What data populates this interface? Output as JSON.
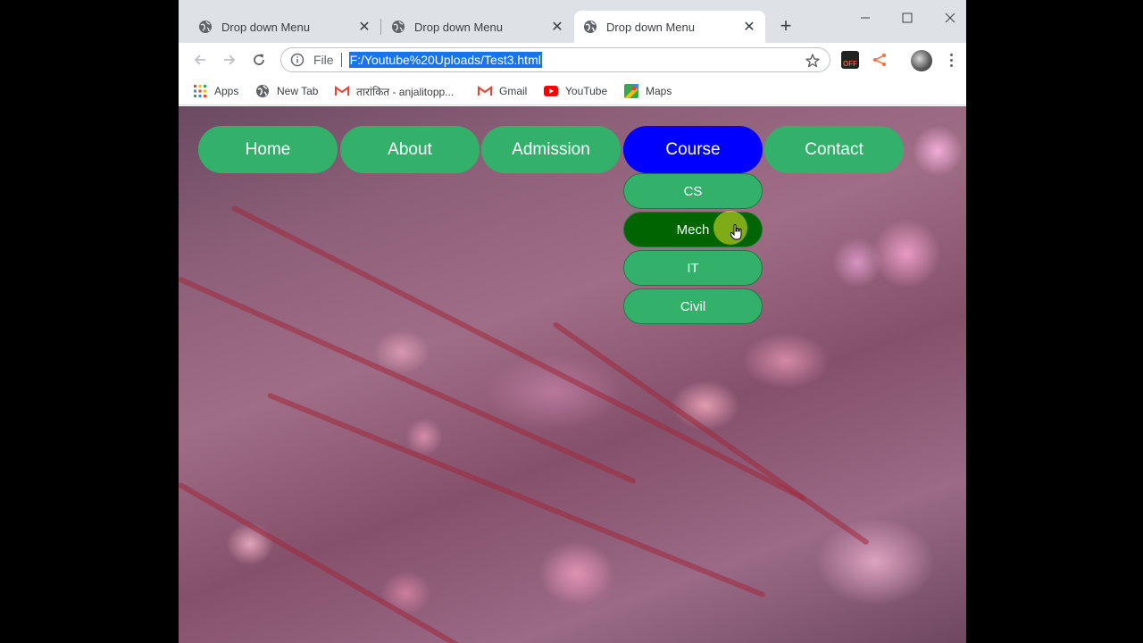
{
  "browser": {
    "tabs": [
      {
        "title": "Drop down Menu",
        "active": false
      },
      {
        "title": "Drop down Menu",
        "active": false
      },
      {
        "title": "Drop down Menu",
        "active": true
      }
    ],
    "address": {
      "scheme": "File",
      "url": "F:/Youtube%20Uploads/Test3.html"
    },
    "bookmarks": [
      {
        "label": "Apps",
        "icon": "apps-grid-icon"
      },
      {
        "label": "New Tab",
        "icon": "globe-icon"
      },
      {
        "label": "तारांकित - anjalitopp...",
        "icon": "gmail-icon"
      },
      {
        "label": "Gmail",
        "icon": "gmail-icon"
      },
      {
        "label": "YouTube",
        "icon": "youtube-icon"
      },
      {
        "label": "Maps",
        "icon": "maps-icon"
      }
    ],
    "extension_label": "OFF"
  },
  "menu": {
    "items": [
      "Home",
      "About",
      "Admission",
      "Course",
      "Contact"
    ],
    "active_item": "Course",
    "dropdown": [
      "CS",
      "Mech",
      "IT",
      "Civil"
    ],
    "hover_item": "Mech"
  },
  "colors": {
    "menu_green": "#33b16b",
    "menu_active_blue": "#0000ff",
    "submenu_hover_green": "#006400",
    "url_selection": "#1a73e8"
  }
}
